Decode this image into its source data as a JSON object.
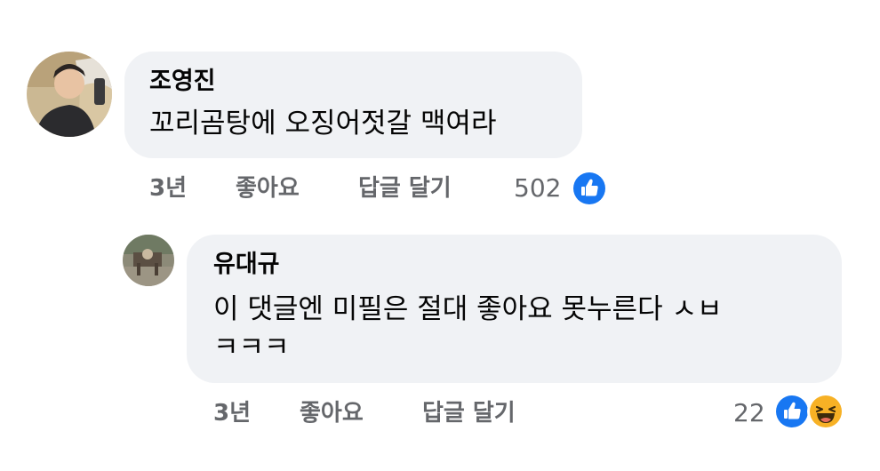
{
  "comments": [
    {
      "author": "조영진",
      "text": "꼬리곰탕에 오징어젓갈 맥여라",
      "time": "3년",
      "like_label": "좋아요",
      "reply_label": "답글 달기",
      "reaction_count": "502",
      "reactions": [
        "like-icon"
      ]
    }
  ],
  "reply": {
    "author": "유대규",
    "text_line1": "이 댓글엔 미필은 절대 좋아요 못누른다 ㅅㅂ",
    "text_line2": "ㅋㅋㅋ",
    "time": "3년",
    "like_label": "좋아요",
    "reply_label": "답글 달기",
    "reaction_count": "22",
    "reactions": [
      "like-icon",
      "haha-icon"
    ]
  },
  "colors": {
    "like_blue": "#1877f2",
    "haha_yellow": "#f7b125",
    "bubble_bg": "#f0f2f5",
    "meta_gray": "#65676b"
  }
}
